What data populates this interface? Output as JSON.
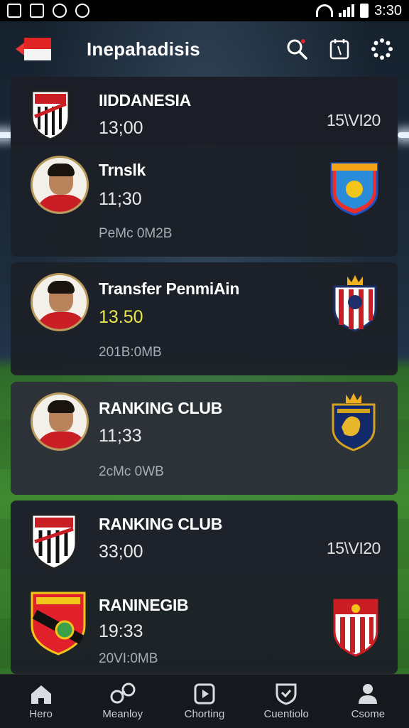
{
  "status_bar": {
    "time": "3:30"
  },
  "header": {
    "title": "Inepahadisis",
    "icons": [
      "flag-back-icon",
      "search-icon",
      "calendar-icon",
      "settings-icon"
    ]
  },
  "cards": [
    {
      "head": {
        "name": "IIDDANESIA",
        "time": "13;00",
        "score": "15\\VI20"
      },
      "row": {
        "name": "Trnslk",
        "time": "11;30",
        "meta": "PeMc 0M2B"
      }
    },
    {
      "name": "Transfer PenmiAin",
      "time": "13.50",
      "meta": "201B:0MB"
    },
    {
      "name": "RANKING CLUB",
      "time": "11;33",
      "meta": "2cMc 0WB"
    },
    {
      "head": {
        "name": "RANKING CLUB",
        "time": "33;00",
        "score": "15\\VI20"
      },
      "row": {
        "name": "RANINEGIB",
        "time": "19:33",
        "meta": "20VI:0MB"
      }
    }
  ],
  "nav": [
    {
      "label": "Hero",
      "icon": "home-icon"
    },
    {
      "label": "Meanloy",
      "icon": "ball-icon"
    },
    {
      "label": "Chorting",
      "icon": "video-icon"
    },
    {
      "label": "Cuentiolo",
      "icon": "shield-icon"
    },
    {
      "label": "Csome",
      "icon": "profile-icon"
    }
  ],
  "colors": {
    "accent_red": "#e02424",
    "time_highlight": "#e6e84a",
    "card_bg": "#1c2028"
  }
}
